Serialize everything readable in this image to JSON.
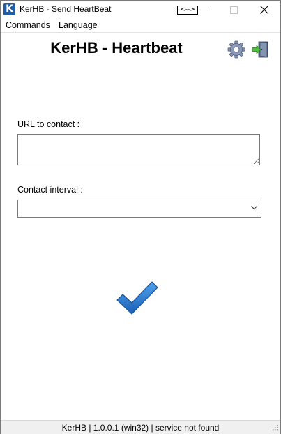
{
  "window": {
    "app_icon_letter": "K",
    "title": "KerHB - Send HeartBeat",
    "rdp_indicator": "<-->"
  },
  "menu": {
    "commands_hotkey": "C",
    "commands_rest": "ommands",
    "language_hotkey": "L",
    "language_rest": "anguage"
  },
  "header": {
    "title": "KerHB - Heartbeat",
    "settings_icon": "gear-icon",
    "exit_icon": "exit-door-icon"
  },
  "form": {
    "url_label": "URL to contact :",
    "url_value": "",
    "interval_label": "Contact interval :",
    "interval_selected": ""
  },
  "action": {
    "icon": "checkmark-icon",
    "color": "#2e7fd1"
  },
  "status": {
    "text": "KerHB | 1.0.0.1 (win32) | service not found"
  }
}
